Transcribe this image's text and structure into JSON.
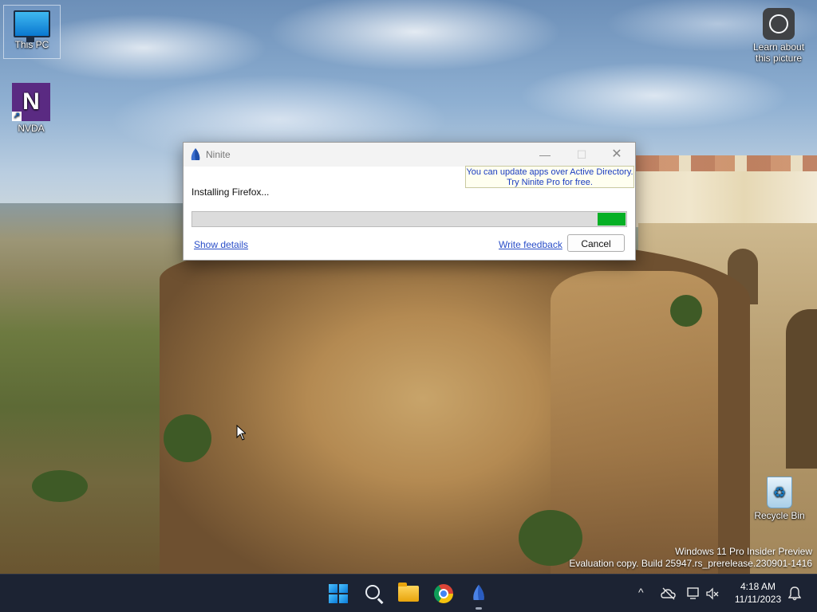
{
  "desktop": {
    "icons": [
      {
        "label": "This PC"
      },
      {
        "label": "NVDA",
        "glyph": "N"
      },
      {
        "label": "Learn about this picture"
      },
      {
        "label": "Recycle Bin"
      }
    ],
    "watermark": {
      "line1": "Windows 11 Pro Insider Preview",
      "line2": "Evaluation copy. Build 25947.rs_prerelease.230901-1416"
    }
  },
  "ninite": {
    "title": "Ninite",
    "promo_line1": "You can update apps over Active Directory.",
    "promo_line2": "Try Ninite Pro for free.",
    "status": "Installing Firefox...",
    "progress": {
      "start_fraction": 0.935,
      "end_fraction": 1.0,
      "color": "#06b025"
    },
    "show_details": "Show details",
    "write_feedback": "Write feedback",
    "cancel": "Cancel",
    "controls": {
      "minimize": "—",
      "maximize": "☐",
      "close": "✕"
    }
  },
  "taskbar": {
    "apps": [
      "start-icon",
      "search-icon",
      "file-explorer-icon",
      "chrome-icon",
      "ninite-icon"
    ],
    "tray": {
      "chevron": "^",
      "time": "4:18 AM",
      "date": "11/11/2023"
    }
  }
}
